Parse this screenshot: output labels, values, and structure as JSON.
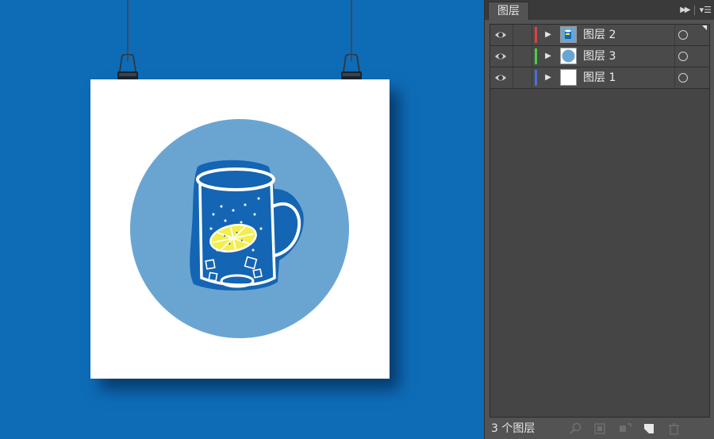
{
  "canvas": {
    "background_color": "#0e6cb7",
    "paper_color": "#ffffff",
    "circle_color": "#6aa5d2",
    "mug_color": "#1465b3",
    "lemon_color": "#f3ee4c"
  },
  "panel": {
    "tab_label": "图层",
    "header_icons": [
      "collapse-icon",
      "panel-menu-icon"
    ],
    "layers": [
      {
        "label": "图层 2",
        "color": "#e04040",
        "thumbnail": "mug-thumbnail",
        "selected_corner": true
      },
      {
        "label": "图层 3",
        "color": "#4ccc44",
        "thumbnail": "circle-thumbnail",
        "selected_corner": false
      },
      {
        "label": "图层 1",
        "color": "#4a6fd8",
        "thumbnail": "blank-thumbnail",
        "selected_corner": false
      }
    ],
    "footer": {
      "count_label": "3 个图层",
      "icons": [
        "locate-object-icon",
        "make-clipping-mask-icon",
        "create-sublayer-icon",
        "create-new-layer-icon",
        "delete-layer-icon"
      ]
    }
  }
}
